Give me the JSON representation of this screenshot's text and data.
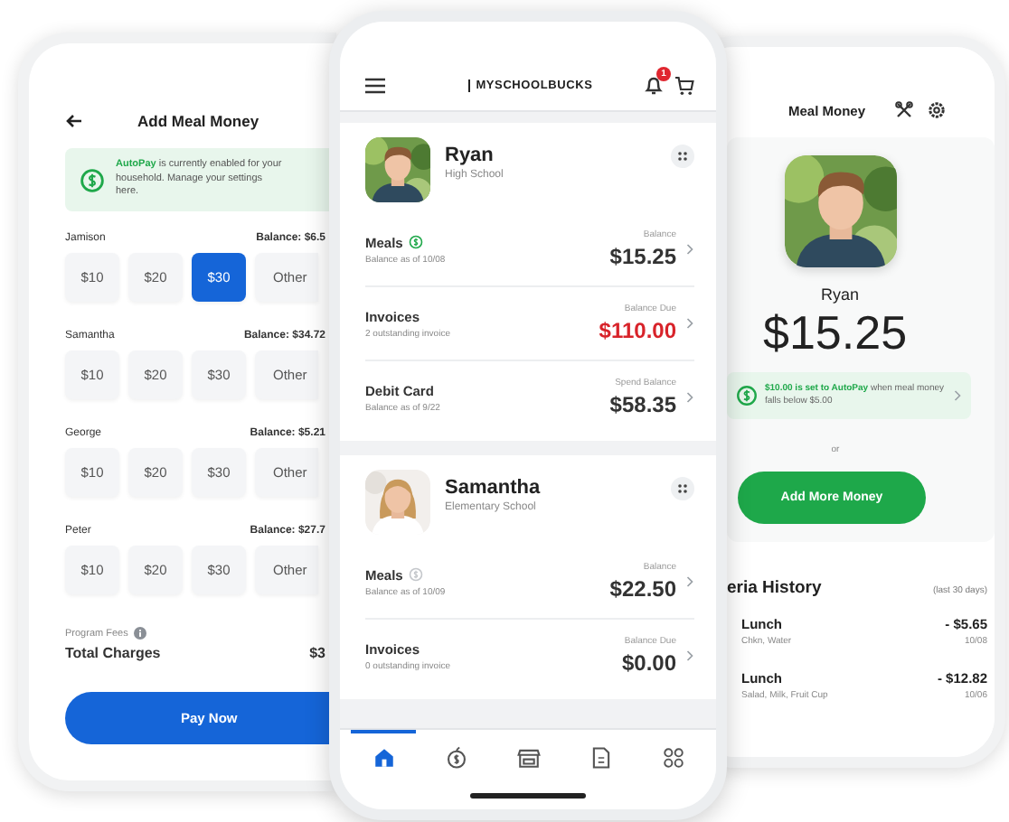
{
  "left_phone": {
    "title": "Add Meal Money",
    "banner": "**AutoPay** is currently enabled for your household. Manage your settings here.",
    "students": [
      {
        "name": "Jamison",
        "balance": "Balance: $6.5",
        "amounts": [
          {
            "label": "$10",
            "selected": false
          },
          {
            "label": "$20",
            "selected": false
          },
          {
            "label": "$30",
            "selected": true
          },
          {
            "label": "Other",
            "selected": false
          }
        ]
      },
      {
        "name": "Samantha",
        "balance": "Balance: $34.72",
        "amounts": [
          {
            "label": "$10",
            "selected": false
          },
          {
            "label": "$20",
            "selected": false
          },
          {
            "label": "$30",
            "selected": false
          },
          {
            "label": "Other",
            "selected": false
          }
        ]
      },
      {
        "name": "George",
        "balance": "Balance: $5.21",
        "amounts": [
          {
            "label": "$10",
            "selected": false
          },
          {
            "label": "$20",
            "selected": false
          },
          {
            "label": "$30",
            "selected": false
          },
          {
            "label": "Other",
            "selected": false
          }
        ]
      },
      {
        "name": "Peter",
        "balance": "Balance: $27.7",
        "amounts": [
          {
            "label": "$10",
            "selected": false
          },
          {
            "label": "$20",
            "selected": false
          },
          {
            "label": "$30",
            "selected": false
          },
          {
            "label": "Other",
            "selected": false
          }
        ]
      }
    ],
    "fees_label": "Program Fees",
    "total_label": "Total Charges",
    "total_value": "$3",
    "pay_button": "Pay Now"
  },
  "center_phone": {
    "logo": "MYSCHOOLBUCKS",
    "notification_count": "1",
    "students": [
      {
        "name": "Ryan",
        "school": "High School",
        "accounts": [
          {
            "kind": "meals",
            "title": "Meals",
            "autopay": true,
            "subtitle": "Balance as of 10/08",
            "amount_label": "Balance",
            "amount": "$15.25",
            "overdue": false
          },
          {
            "kind": "invoices",
            "title": "Invoices",
            "subtitle": "2 outstanding invoice",
            "amount_label": "Balance Due",
            "amount": "$110.00",
            "overdue": true
          },
          {
            "kind": "card",
            "title": "Debit Card",
            "subtitle": "Balance as of 9/22",
            "amount_label": "Spend Balance",
            "amount": "$58.35",
            "overdue": false
          }
        ]
      },
      {
        "name": "Samantha",
        "school": "Elementary School",
        "accounts": [
          {
            "kind": "meals",
            "title": "Meals",
            "autopay": false,
            "subtitle": "Balance as of 10/09",
            "amount_label": "Balance",
            "amount": "$22.50",
            "overdue": false
          },
          {
            "kind": "invoices",
            "title": "Invoices",
            "subtitle": "0 outstanding invoice",
            "amount_label": "Balance Due",
            "amount": "$0.00",
            "overdue": false
          }
        ]
      }
    ],
    "nav": [
      {
        "kind": "home",
        "selected": true
      },
      {
        "kind": "meals",
        "selected": false
      },
      {
        "kind": "store",
        "selected": false
      },
      {
        "kind": "document",
        "selected": false
      },
      {
        "kind": "more",
        "selected": false
      }
    ]
  },
  "right_phone": {
    "title": "Meal Money",
    "name": "Ryan",
    "balance": "$15.25",
    "autopay_notice": "**$10.00 is set to AutoPay** when meal money falls below $5.00",
    "separator": "or",
    "add_button": "Add More Money",
    "history": {
      "title": "eria History",
      "period": "(last 30 days)",
      "rows": [
        {
          "title": "Lunch",
          "items": "Chkn, Water",
          "amount": "- $5.65",
          "date": "10/08"
        },
        {
          "title": "Lunch",
          "items": "Salad, Milk, Fruit Cup",
          "amount": "- $12.82",
          "date": "10/06"
        }
      ]
    }
  }
}
